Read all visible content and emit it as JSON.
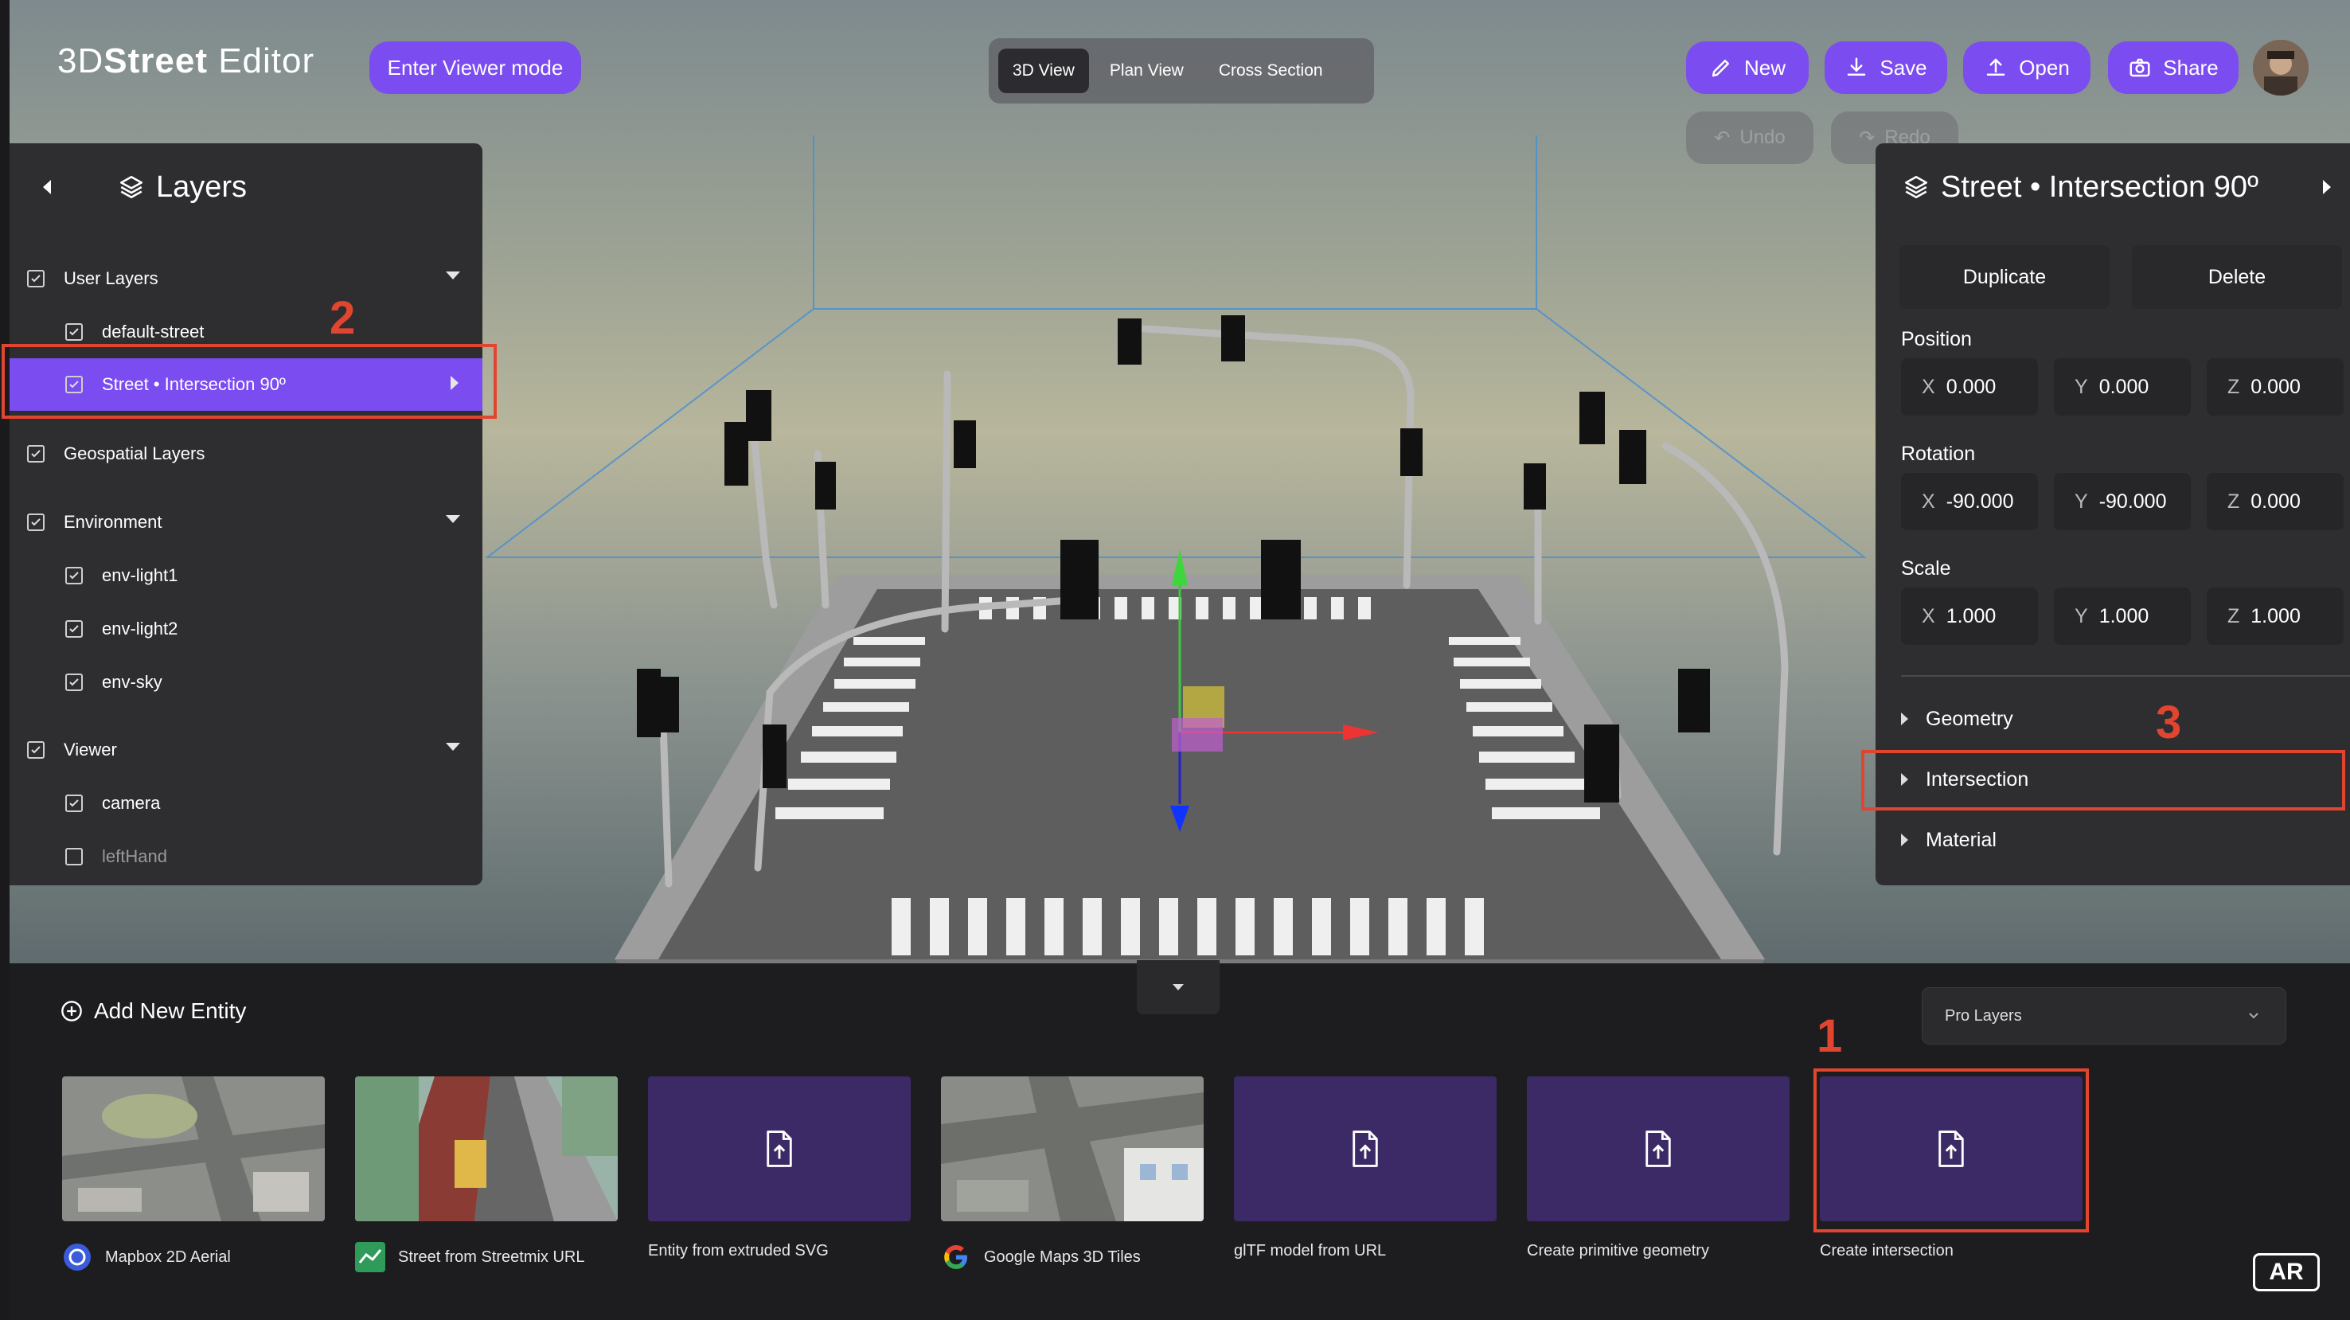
{
  "header": {
    "brand_light_1": "3D",
    "brand_bold": "Street",
    "brand_light_2": " Editor",
    "viewer_mode_label": "Enter Viewer mode",
    "view_tabs": [
      {
        "label": "3D View",
        "active": true
      },
      {
        "label": "Plan View",
        "active": false
      },
      {
        "label": "Cross Section",
        "active": false
      }
    ],
    "actions": {
      "new_label": "New",
      "save_label": "Save",
      "open_label": "Open",
      "share_label": "Share",
      "undo_label": "Undo",
      "redo_label": "Redo"
    }
  },
  "layers_panel": {
    "title": "Layers",
    "items": [
      {
        "label": "User Layers",
        "checked": true,
        "level": 0,
        "expanded": true
      },
      {
        "label": "default-street",
        "checked": true,
        "level": 1
      },
      {
        "label": "Street • Intersection 90º",
        "checked": true,
        "level": 1,
        "selected": true
      },
      {
        "label": "Geospatial Layers",
        "checked": true,
        "level": 0
      },
      {
        "label": "Environment",
        "checked": true,
        "level": 0,
        "expanded": true
      },
      {
        "label": "env-light1",
        "checked": true,
        "level": 1
      },
      {
        "label": "env-light2",
        "checked": true,
        "level": 1
      },
      {
        "label": "env-sky",
        "checked": true,
        "level": 1
      },
      {
        "label": "Viewer",
        "checked": true,
        "level": 0,
        "expanded": true
      },
      {
        "label": "camera",
        "checked": true,
        "level": 1
      },
      {
        "label": "leftHand",
        "checked": false,
        "level": 1
      }
    ]
  },
  "properties_panel": {
    "title": "Street • Intersection 90º",
    "duplicate_label": "Duplicate",
    "delete_label": "Delete",
    "position": {
      "label": "Position",
      "x": "0.000",
      "y": "0.000",
      "z": "0.000"
    },
    "rotation": {
      "label": "Rotation",
      "x": "-90.000",
      "y": "-90.000",
      "z": "0.000"
    },
    "scale": {
      "label": "Scale",
      "x": "1.000",
      "y": "1.000",
      "z": "1.000"
    },
    "axis_labels": {
      "x": "X",
      "y": "Y",
      "z": "Z"
    },
    "sections": [
      "Geometry",
      "Intersection",
      "Material"
    ]
  },
  "annotations": [
    "1",
    "2",
    "3"
  ],
  "add_entity": {
    "title": "Add New Entity",
    "dropdown_value": "Pro Layers",
    "cards": [
      {
        "label": "Mapbox 2D Aerial",
        "icon": "mapbox-icon"
      },
      {
        "label": "Street from Streetmix URL",
        "icon": "streetmix-icon"
      },
      {
        "label": "Entity from extruded SVG",
        "icon": "file-upload-icon"
      },
      {
        "label": "Google Maps 3D Tiles",
        "icon": "google-icon"
      },
      {
        "label": "glTF model from URL",
        "icon": "file-upload-icon"
      },
      {
        "label": "Create primitive geometry",
        "icon": "file-upload-icon"
      },
      {
        "label": "Create intersection",
        "icon": "file-upload-icon"
      }
    ]
  },
  "ar_label": "AR",
  "colors": {
    "accent": "#7b4cf0",
    "panel": "#2e2e31",
    "annotation_red": "#e2452f",
    "card_purple": "#3b2a66"
  }
}
